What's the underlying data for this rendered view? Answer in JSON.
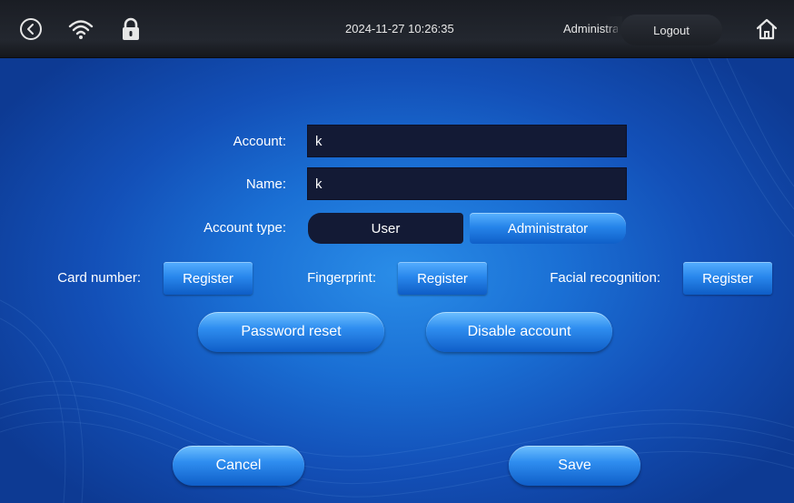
{
  "status_bar": {
    "back_icon": "circle-chevron-left-icon",
    "wifi_icon": "wifi-icon",
    "lock_icon": "lock-icon",
    "datetime": "2024-11-27 10:26:35",
    "user_role": "Administrat",
    "logout_label": "Logout",
    "home_icon": "home-icon"
  },
  "form": {
    "account_label": "Account:",
    "account_value": "k",
    "name_label": "Name:",
    "name_value": "k",
    "account_type_label": "Account type:",
    "account_type_options": [
      "User",
      "Administrator"
    ],
    "account_type_selected": "Administrator"
  },
  "registration": {
    "card_label": "Card number:",
    "card_button": "Register",
    "fingerprint_label": "Fingerprint:",
    "fingerprint_button": "Register",
    "face_label": "Facial recognition:",
    "face_button": "Register"
  },
  "actions": {
    "password_reset": "Password reset",
    "disable_account": "Disable account",
    "cancel": "Cancel",
    "save": "Save"
  },
  "colors": {
    "background": "#1a6fd4",
    "field_bg": "#131a35",
    "button_accent": "#2987ec",
    "topbar": "#1f2229"
  }
}
